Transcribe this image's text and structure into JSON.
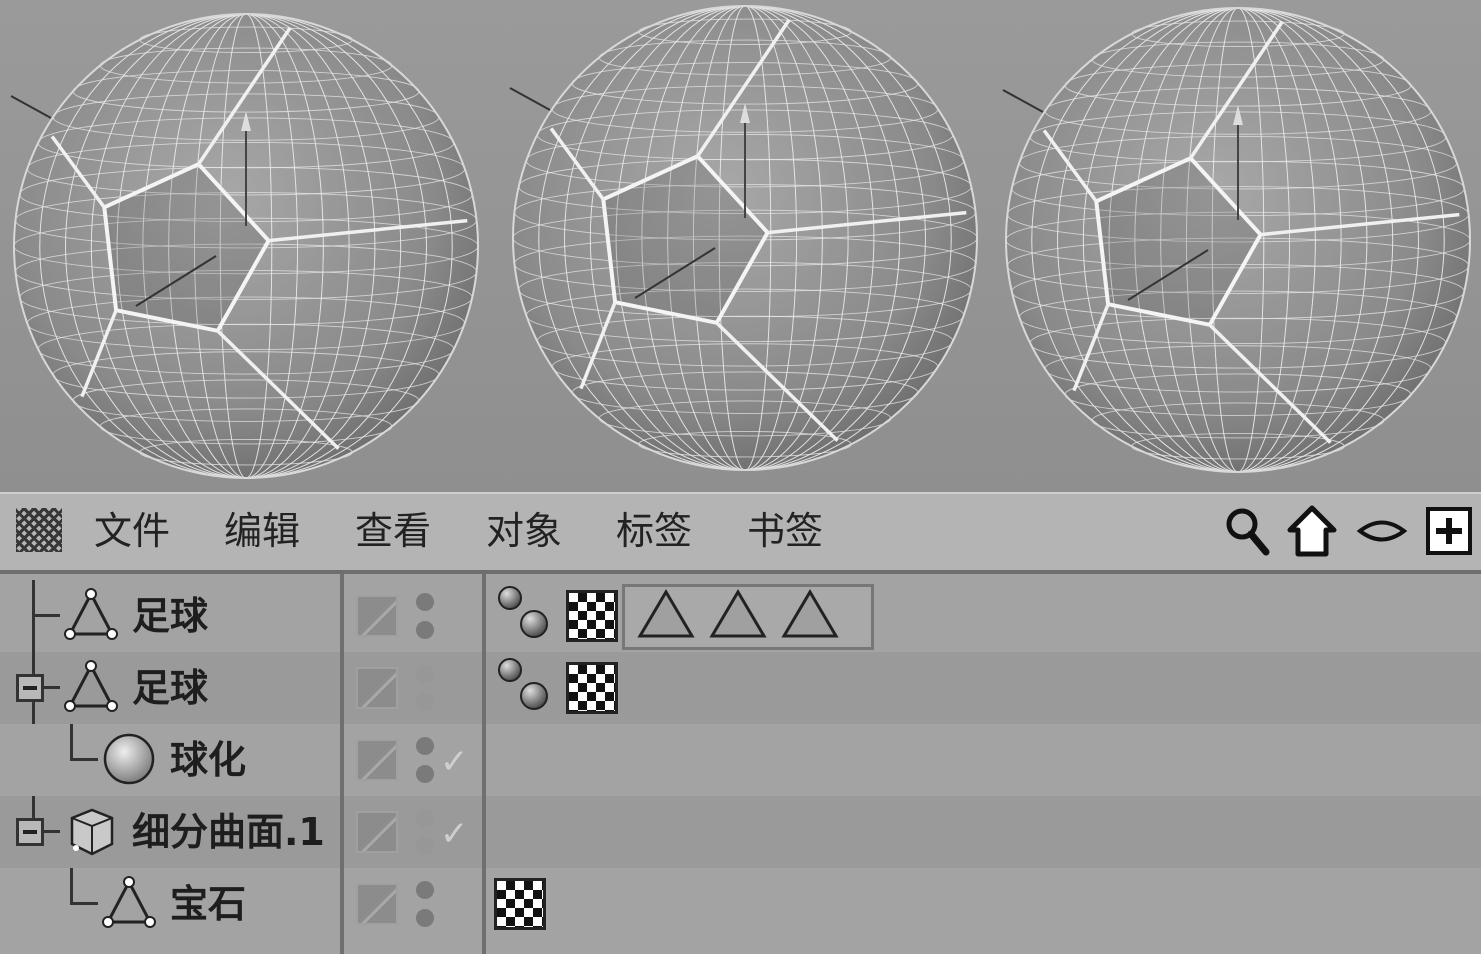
{
  "menu": {
    "items": [
      "文件",
      "编辑",
      "查看",
      "对象",
      "标签",
      "书签"
    ],
    "tools": [
      "search-icon",
      "home-icon",
      "eye-icon",
      "add-panel-icon"
    ]
  },
  "objects": [
    {
      "name": "足球",
      "icon": "polygon-object-icon",
      "expander": false,
      "vis": [
        "dark",
        "dark"
      ],
      "check": false,
      "tags": [
        "phong",
        "checker",
        "selection",
        "selection",
        "selection"
      ]
    },
    {
      "name": "足球",
      "icon": "polygon-object-icon",
      "expander": true,
      "vis": [
        "light",
        "light"
      ],
      "check": false,
      "tags": [
        "phong",
        "checker"
      ]
    },
    {
      "name": "球化",
      "icon": "spherify-deformer-icon",
      "expander": false,
      "vis": [
        "dark",
        "dark"
      ],
      "check": true,
      "tags": []
    },
    {
      "name": "细分曲面.1",
      "icon": "subdivision-surface-icon",
      "expander": true,
      "vis": [
        "light",
        "light"
      ],
      "check": true,
      "tags": []
    },
    {
      "name": "宝石",
      "icon": "polygon-object-icon",
      "expander": false,
      "vis": [
        "dark",
        "dark"
      ],
      "check": false,
      "tags": [
        "checker"
      ]
    }
  ],
  "colors": {
    "viewport_bg": "#9a9a9a",
    "wire": "#e8e8e8",
    "menubar_bg": "#b4b4b4",
    "objmgr_bg": "#a3a3a3"
  }
}
